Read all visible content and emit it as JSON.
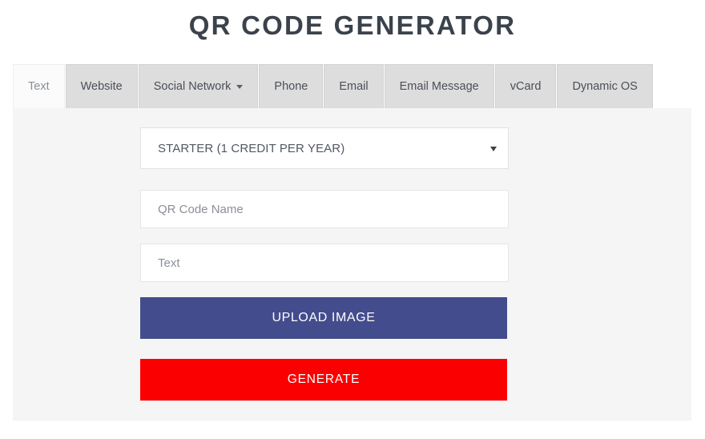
{
  "page": {
    "title": "QR CODE GENERATOR",
    "background": "#ffffff",
    "panel_background": "#f5f5f5",
    "title_color": "#3b424b"
  },
  "tabs": {
    "active_index": 0,
    "items": [
      {
        "label": "Text",
        "active": true,
        "has_caret": false
      },
      {
        "label": "Website",
        "active": false,
        "has_caret": false
      },
      {
        "label": "Social Network",
        "active": false,
        "has_caret": true
      },
      {
        "label": "Phone",
        "active": false,
        "has_caret": false
      },
      {
        "label": "Email",
        "active": false,
        "has_caret": false
      },
      {
        "label": "Email Message",
        "active": false,
        "has_caret": false
      },
      {
        "label": "vCard",
        "active": false,
        "has_caret": false
      },
      {
        "label": "Dynamic OS",
        "active": false,
        "has_caret": false
      }
    ]
  },
  "form": {
    "plan_select": {
      "selected": "STARTER (1 CREDIT PER YEAR)",
      "caret_icon": "chevron-down-icon"
    },
    "qr_name": {
      "value": "",
      "placeholder": "QR Code Name"
    },
    "text_content": {
      "value": "",
      "placeholder": "Text"
    },
    "upload_button": {
      "label": "UPLOAD IMAGE",
      "color": "#434c8c"
    },
    "generate_button": {
      "label": "GENERATE",
      "color": "#fa0000"
    }
  }
}
